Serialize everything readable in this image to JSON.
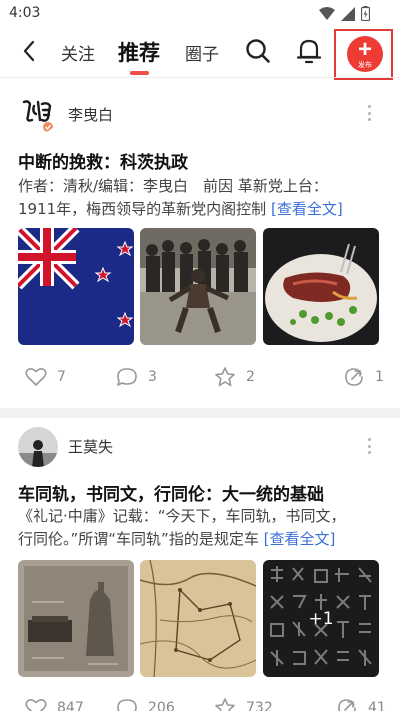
{
  "status_bar": {
    "time": "4:03"
  },
  "nav": {
    "tabs": [
      {
        "label": "关注"
      },
      {
        "label": "推荐"
      },
      {
        "label": "圈子"
      }
    ],
    "publish_label": "发布",
    "accent_color": "#ee3b34"
  },
  "posts": [
    {
      "author": "李曳白",
      "title": "中断的挽救：科茨执政",
      "excerpt_lines": [
        "作者：清秋/编辑：李曳白　前因 革新党上台：",
        "1911年，梅西领导的革新党内阁控制"
      ],
      "read_more": "[查看全文]",
      "images": [
        "new-zealand-flag",
        "maori-haka-group",
        "steak-dish"
      ],
      "likes": "7",
      "comments": "3",
      "stars": "2",
      "shares": "1"
    },
    {
      "author": "王莫失",
      "title": "车同轨，书同文，行同伦：大一统的基础",
      "excerpt_lines": [
        "《礼记·中庸》记载：“今天下，车同轨，书同文，",
        "行同伦。”所谓“车同轨”指的是规定车"
      ],
      "read_more": "[查看全文]",
      "images": [
        "ancient-bronze-weights",
        "ancient-road-map",
        "ancient-script-rubbing"
      ],
      "extra_images": "+1",
      "likes": "847",
      "comments": "206",
      "stars": "732",
      "shares": "41"
    }
  ]
}
